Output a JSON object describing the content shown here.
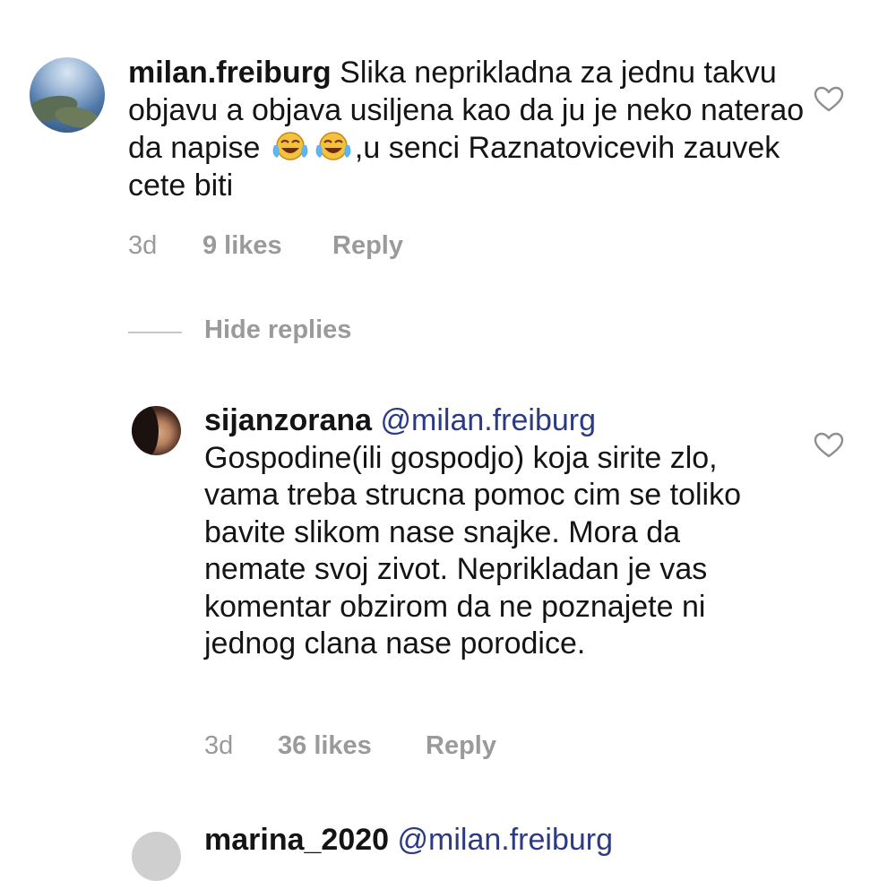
{
  "comment1": {
    "username": "milan.freiburg",
    "text_before_emoji": "Slika neprikladna za jednu takvu objavu a objava usiljena kao da ju je neko naterao da napise",
    "emoji": [
      "face-with-tears-of-joy",
      "face-with-tears-of-joy"
    ],
    "text_after_emoji": ",u senci Raznatovicevih zauvek cete biti",
    "time": "3d",
    "likes": "9 likes",
    "reply": "Reply"
  },
  "replies_toggle": {
    "label": "Hide replies"
  },
  "comment2": {
    "username": "sijanzorana",
    "mention": "@milan.freiburg",
    "text": "Gospodine(ili gospodjo) koja sirite zlo, vama treba strucna pomoc cim se toliko bavite slikom nase snajke. Mora da nemate svoj zivot. Neprikladan je vas komentar obzirom da ne poznajete ni jednog clana nase porodice.",
    "time": "3d",
    "likes": "36 likes",
    "reply": "Reply"
  },
  "comment3": {
    "username": "marina_2020",
    "mention": "@milan.freiburg"
  },
  "icons": {
    "like": "heart-outline-icon"
  },
  "colors": {
    "meta": "#9a9a9a",
    "mention": "#2b3a82",
    "text": "#141414"
  }
}
